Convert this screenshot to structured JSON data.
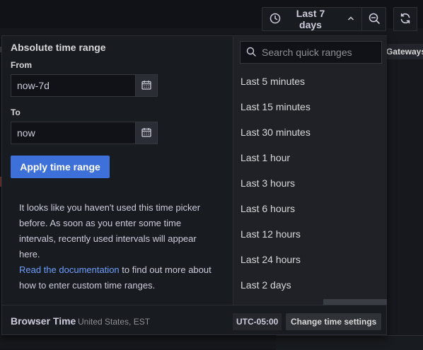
{
  "toolbar": {
    "range_label": "Last 7 days"
  },
  "background": {
    "gateways_label": "Gateways"
  },
  "picker": {
    "title": "Absolute time range",
    "from_label": "From",
    "from_value": "now-7d",
    "to_label": "To",
    "to_value": "now",
    "apply_label": "Apply time range",
    "info_text": "It looks like you haven't used this time picker before. As soon as you enter some time intervals, recently used intervals will appear here.",
    "docs_link": "Read the documentation",
    "info_text_after": " to find out more about how to enter custom time ranges.",
    "search_placeholder": "Search quick ranges",
    "quick_ranges": [
      "Last 5 minutes",
      "Last 15 minutes",
      "Last 30 minutes",
      "Last 1 hour",
      "Last 3 hours",
      "Last 6 hours",
      "Last 12 hours",
      "Last 24 hours",
      "Last 2 days"
    ]
  },
  "footer": {
    "timezone_name": "Browser Time",
    "timezone_region": "United States, EST",
    "utc_offset": "UTC-05:00",
    "change_label": "Change time settings"
  },
  "colors": {
    "accent": "#3d71d9",
    "link": "#6e9fff",
    "panel": "#181b1f"
  },
  "icons": [
    "clock-icon",
    "chevron-up-icon",
    "zoom-out-icon",
    "refresh-icon",
    "calendar-icon",
    "search-icon"
  ]
}
